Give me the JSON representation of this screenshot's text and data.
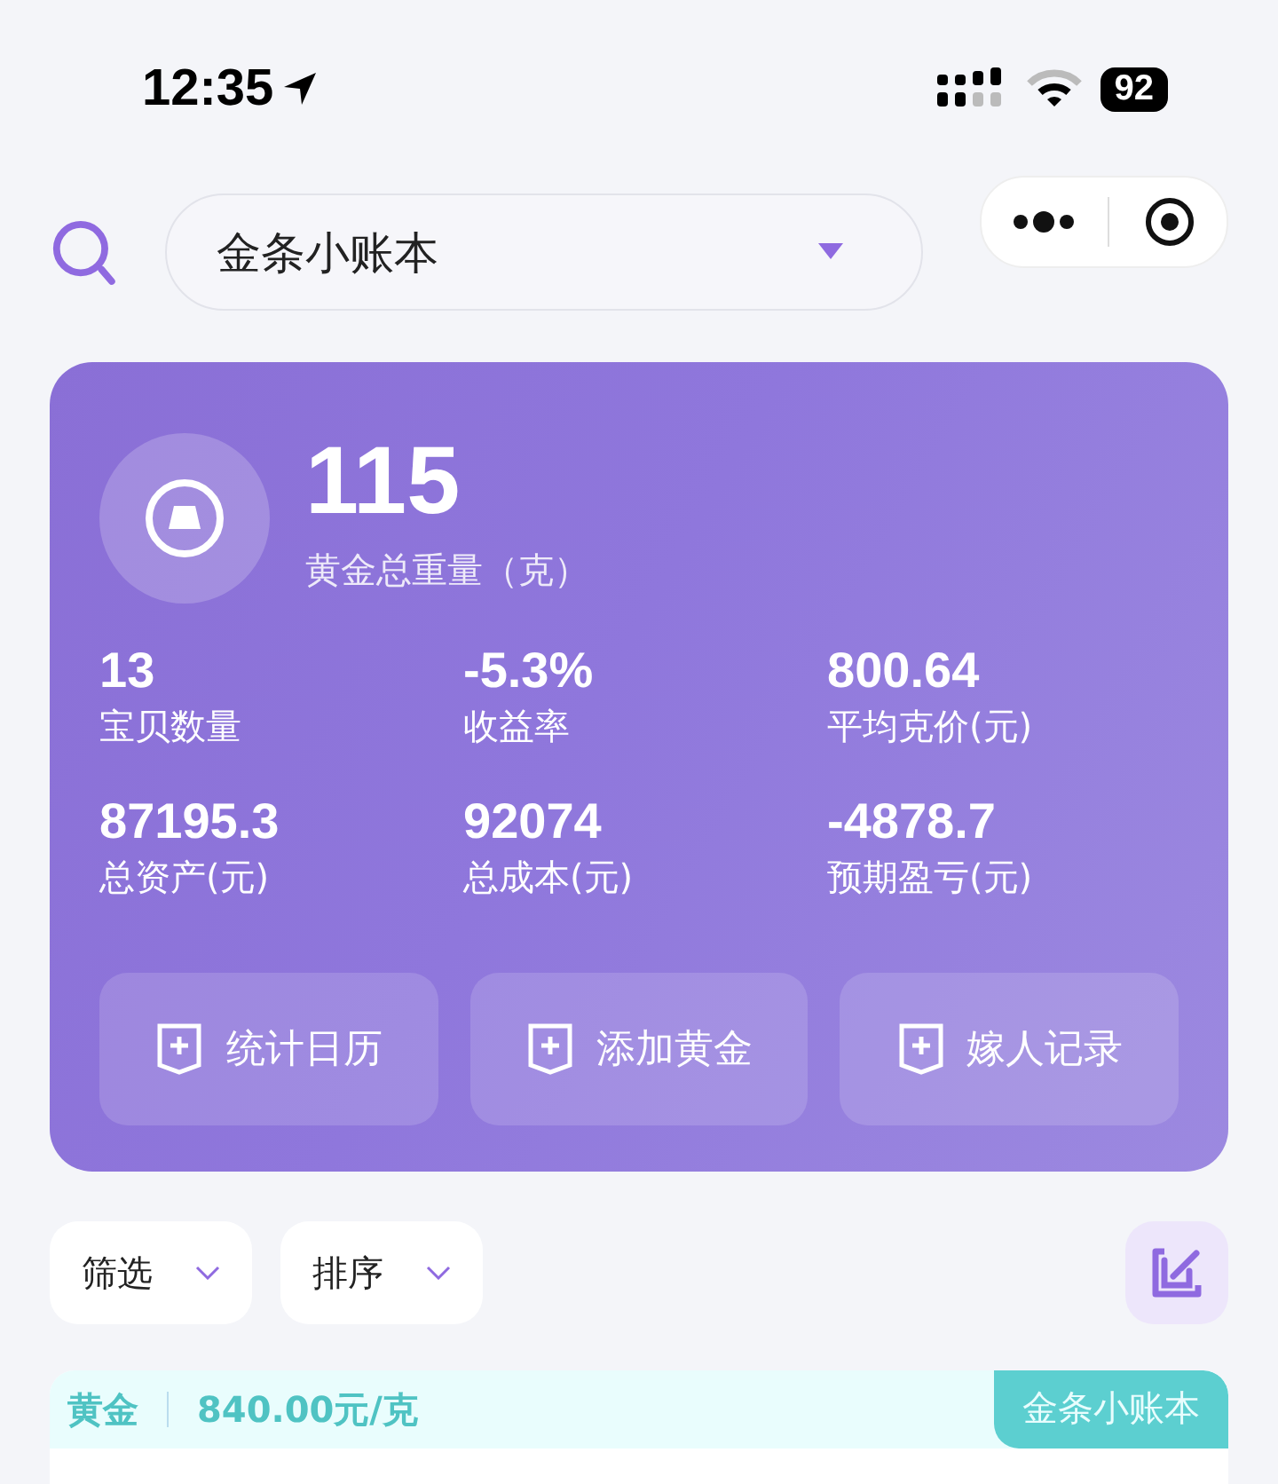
{
  "status_bar": {
    "time": "12:35",
    "battery": "92"
  },
  "header": {
    "book_select": {
      "value": "金条小账本"
    }
  },
  "summary": {
    "total_weight": "115",
    "total_weight_label": "黄金总重量（克）",
    "stats": [
      {
        "value": "13",
        "label": "宝贝数量"
      },
      {
        "value": "-5.3%",
        "label": "收益率"
      },
      {
        "value": "800.64",
        "label": "平均克价(元)"
      },
      {
        "value": "87195.3",
        "label": "总资产(元)"
      },
      {
        "value": "92074",
        "label": "总成本(元)"
      },
      {
        "value": "-4878.7",
        "label": "预期盈亏(元)"
      }
    ],
    "actions": [
      "统计日历",
      "添加黄金",
      "嫁人记录"
    ]
  },
  "filters": [
    {
      "label": "筛选"
    },
    {
      "label": "排序"
    }
  ],
  "item": {
    "type": "黄金",
    "price": "840.00元/克",
    "book_tag": "金条小账本"
  }
}
